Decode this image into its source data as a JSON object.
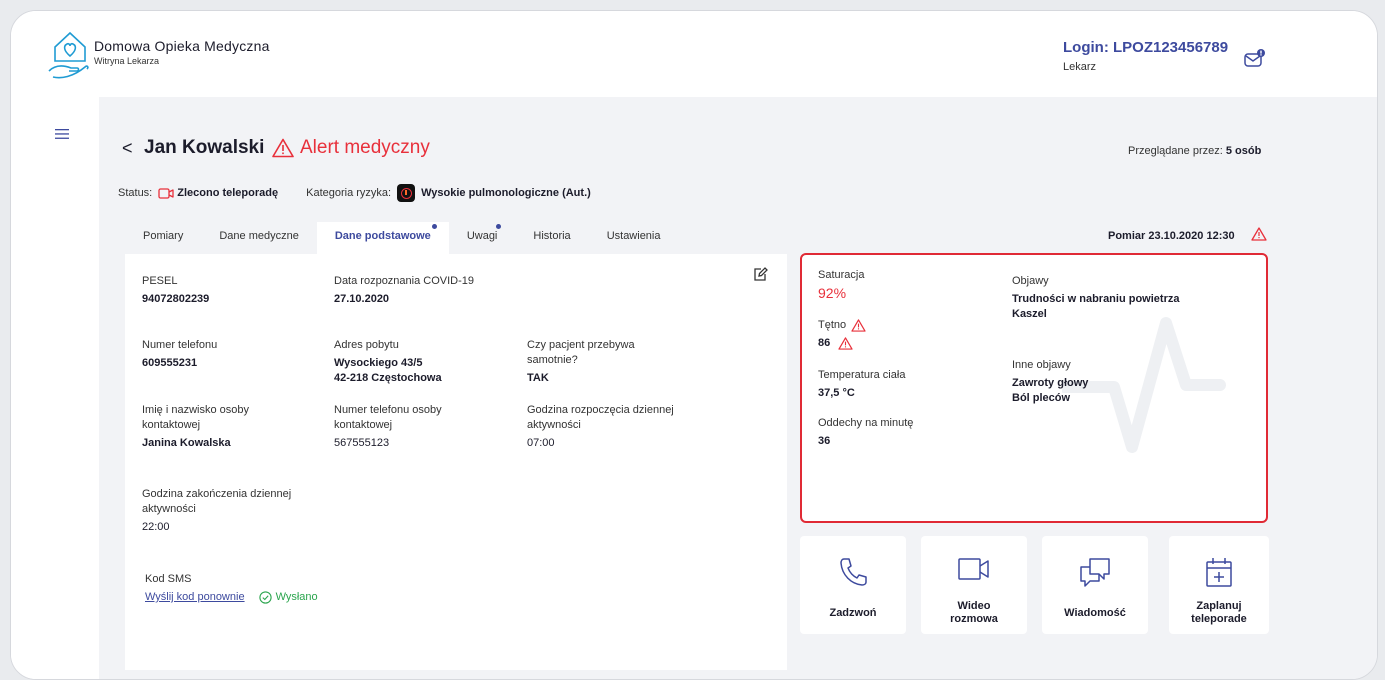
{
  "brand": {
    "title": "Domowa Opieka Medyczna",
    "subtitle": "Witryna Lekarza"
  },
  "user": {
    "login": "Login: LPOZ123456789",
    "role": "Lekarz"
  },
  "patient": {
    "back": "<",
    "name": "Jan Kowalski",
    "alert": "Alert medyczny",
    "viewers_label": "Przeglądane przez:",
    "viewers_value": "5 osób"
  },
  "status": {
    "label": "Status:",
    "value": "Zlecono teleporadę",
    "risk_label": "Kategoria ryzyka:",
    "risk_value": "Wysokie pulmonologiczne (Aut.)"
  },
  "tabs": [
    {
      "label": "Pomiary"
    },
    {
      "label": "Dane medyczne"
    },
    {
      "label": "Dane podstawowe"
    },
    {
      "label": "Uwagi"
    },
    {
      "label": "Historia"
    },
    {
      "label": "Ustawienia"
    }
  ],
  "measurement": {
    "title": "Pomiar 23.10.2020  12:30"
  },
  "basic": {
    "pesel": {
      "label": "PESEL",
      "value": "94072802239"
    },
    "covid": {
      "label": "Data rozpoznania COVID-19",
      "value": "27.10.2020"
    },
    "phone": {
      "label": "Numer telefonu",
      "value": "609555231"
    },
    "address": {
      "label": "Adres pobytu",
      "line1": "Wysockiego 43/5",
      "line2": "42-218 Częstochowa"
    },
    "alone": {
      "label1": "Czy pacjent przebywa",
      "label2": "samotnie?",
      "value": "TAK"
    },
    "contact_name": {
      "label1": "Imię i nazwisko osoby",
      "label2": "kontaktowej",
      "value": "Janina Kowalska"
    },
    "contact_phone": {
      "label1": "Numer telefonu osoby",
      "label2": "kontaktowej",
      "value": "567555123"
    },
    "start": {
      "label1": "Godzina rozpoczęcia dziennej",
      "label2": "aktywności",
      "value": "07:00"
    },
    "end": {
      "label1": "Godzina zakończenia dziennej",
      "label2": "aktywności",
      "value": "22:00"
    },
    "sms": {
      "label": "Kod SMS",
      "link": "Wyślij kod ponownie",
      "sent": "Wysłano"
    }
  },
  "vitals": {
    "saturation": {
      "label": "Saturacja",
      "value": "92%"
    },
    "pulse": {
      "label": "Tętno",
      "value": "86"
    },
    "temperature": {
      "label": "Temperatura ciała",
      "value": "37,5 °C"
    },
    "breaths": {
      "label": "Oddechy na minutę",
      "value": "36"
    },
    "symptoms": {
      "label": "Objawy",
      "line1": "Trudności w nabraniu powietrza",
      "line2": "Kaszel"
    },
    "other": {
      "label": "Inne objawy",
      "line1": "Zawroty głowy",
      "line2": "Ból pleców"
    }
  },
  "actions": {
    "call": "Zadzwoń",
    "video1": "Wideo",
    "video2": "rozmowa",
    "message": "Wiadomość",
    "schedule1": "Zaplanuj",
    "schedule2": "teleporade"
  },
  "colors": {
    "accent": "#3d4a9e",
    "alert": "#e8303b",
    "success": "#2aa54d",
    "icon": "#1f9bd3"
  }
}
